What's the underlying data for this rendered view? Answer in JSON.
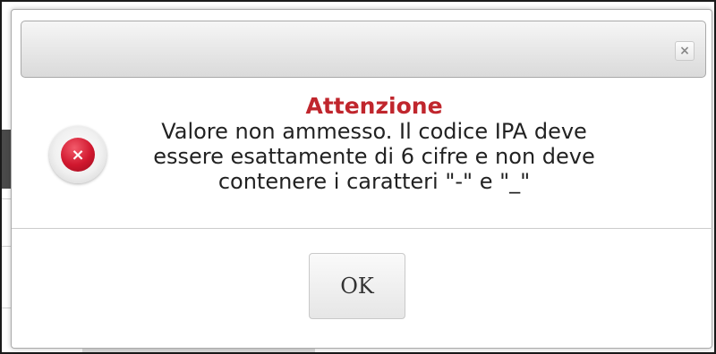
{
  "dialog": {
    "close_label": "×",
    "close_icon": "close-icon",
    "error_icon": "error-icon",
    "error_icon_glyph": "×",
    "title": "Attenzione",
    "message_lines": [
      "Valore non ammesso. Il codice IPA deve",
      "essere esattamente di 6 cifre e non deve",
      "contenere i caratteri \"-\" e \"_\""
    ],
    "ok_label": "OK"
  },
  "colors": {
    "title": "#c0262d",
    "error_icon": "#d0172e",
    "titlebar": "#dadada"
  }
}
